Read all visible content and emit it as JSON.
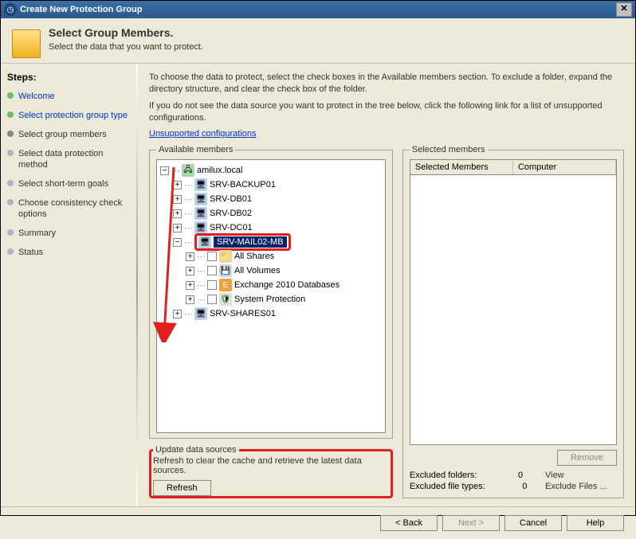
{
  "window": {
    "title": "Create New Protection Group"
  },
  "header": {
    "title": "Select Group Members.",
    "subtitle": "Select the data that you want to protect."
  },
  "steps": {
    "heading": "Steps:",
    "items": [
      {
        "label": "Welcome",
        "state": "done"
      },
      {
        "label": "Select protection group type",
        "state": "done"
      },
      {
        "label": "Select group members",
        "state": "active"
      },
      {
        "label": "Select data protection method",
        "state": "pending"
      },
      {
        "label": "Select short-term goals",
        "state": "pending"
      },
      {
        "label": "Choose consistency check options",
        "state": "pending"
      },
      {
        "label": "Summary",
        "state": "pending"
      },
      {
        "label": "Status",
        "state": "pending"
      }
    ]
  },
  "main": {
    "intro1": "To choose the data to protect, select the check boxes in the Available members section. To exclude a folder, expand the directory structure, and clear the check box of the folder.",
    "intro2": "If you do not see the data source you want to protect in the tree below, click the following link for a list of unsupported configurations.",
    "link": "Unsupported configurations",
    "available_legend": "Available members",
    "update_legend": "Update data sources",
    "update_text": "Refresh to clear the cache and retrieve the latest data sources.",
    "refresh_btn": "Refresh",
    "selected_legend": "Selected members",
    "col1": "Selected Members",
    "col2": "Computer",
    "remove_btn": "Remove",
    "excl_folders_lbl": "Excluded folders:",
    "excl_folders_val": "0",
    "excl_folders_act": "View",
    "excl_types_lbl": "Excluded file types:",
    "excl_types_val": "0",
    "excl_types_act": "Exclude Files ..."
  },
  "tree": {
    "root": "amilux.local",
    "servers": [
      "SRV-BACKUP01",
      "SRV-DB01",
      "SRV-DB02",
      "SRV-DC01"
    ],
    "selected": "SRV-MAIL02-MB",
    "children": [
      "All Shares",
      "All Volumes",
      "Exchange 2010 Databases",
      "System Protection"
    ],
    "last": "SRV-SHARES01"
  },
  "footer": {
    "back": "< Back",
    "next": "Next >",
    "cancel": "Cancel",
    "help": "Help"
  }
}
